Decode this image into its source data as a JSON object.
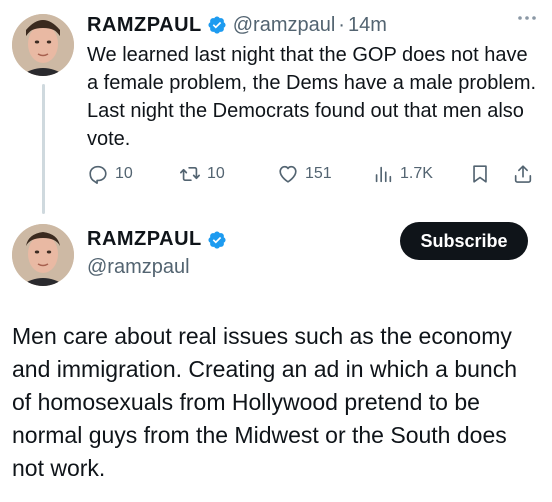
{
  "colors": {
    "text_primary": "#0f1419",
    "text_secondary": "#536471",
    "verified_blue": "#1d9bf0",
    "subscribe_bg": "#0f1419",
    "subscribe_text": "#ffffff"
  },
  "tweet1": {
    "author_name": "RAMZPAUL",
    "author_handle": "@ramzpaul",
    "separator": "·",
    "time": "14m",
    "more_icon": "more-icon",
    "text": "We learned last night that the GOP does not have a female problem, the Dems have a male problem. Last night the Democrats found out that men also vote.",
    "actions": {
      "reply_count": "10",
      "retweet_count": "10",
      "like_count": "151",
      "view_count": "1.7K"
    }
  },
  "tweet2": {
    "author_name": "RAMZPAUL",
    "author_handle": "@ramzpaul",
    "subscribe_label": "Subscribe",
    "text": "Men care about real issues such as the economy and immigration.  Creating an ad in which a bunch of homosexuals from Hollywood pretend to be normal guys from the Midwest or the South does not work."
  }
}
